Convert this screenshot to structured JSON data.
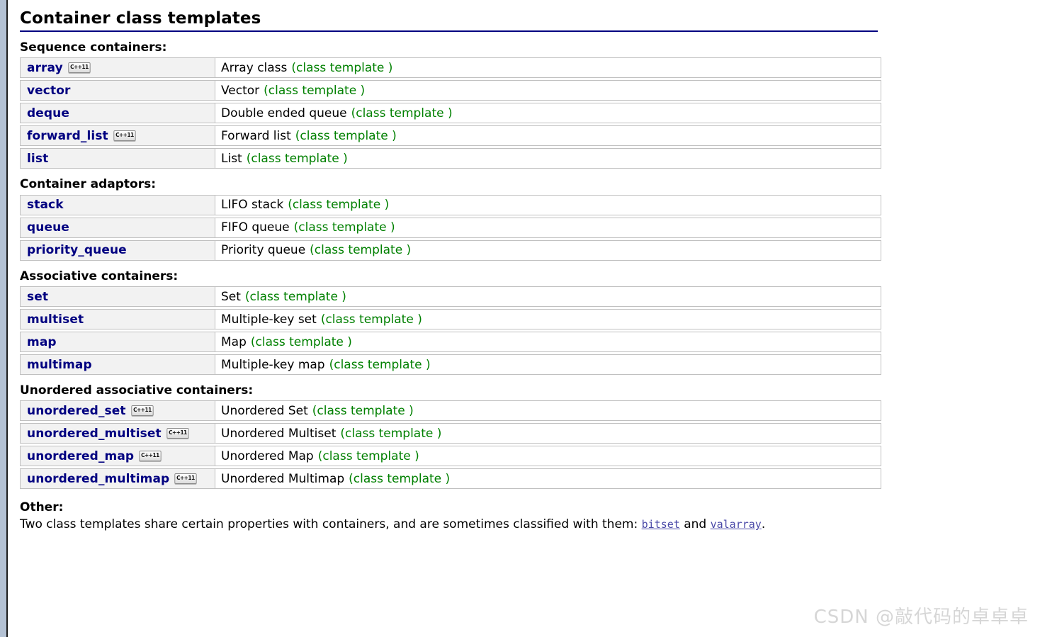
{
  "page": {
    "title": "Container class templates",
    "badge_label": "C++11",
    "template_note": "(class template )"
  },
  "sections": [
    {
      "heading": "Sequence containers",
      "colon": ":",
      "fixed_column": true,
      "rows": [
        {
          "name": "array",
          "badge": true,
          "desc": "Array class",
          "template": "(class template )"
        },
        {
          "name": "vector",
          "badge": false,
          "desc": "Vector",
          "template": "(class template )"
        },
        {
          "name": "deque",
          "badge": false,
          "desc": "Double ended queue",
          "template": "(class template )"
        },
        {
          "name": "forward_list",
          "badge": true,
          "desc": "Forward list",
          "template": "(class template )"
        },
        {
          "name": "list",
          "badge": false,
          "desc": "List",
          "template": "(class template )"
        }
      ]
    },
    {
      "heading": "Container adaptors",
      "colon": ":",
      "fixed_column": true,
      "rows": [
        {
          "name": "stack",
          "badge": false,
          "desc": "LIFO stack",
          "template": "(class template )"
        },
        {
          "name": "queue",
          "badge": false,
          "desc": "FIFO queue",
          "template": "(class template )"
        },
        {
          "name": "priority_queue",
          "badge": false,
          "desc": "Priority queue",
          "template": "(class template )"
        }
      ]
    },
    {
      "heading": "Associative containers",
      "colon": ":",
      "fixed_column": true,
      "rows": [
        {
          "name": "set",
          "badge": false,
          "desc": "Set",
          "template": "(class template )"
        },
        {
          "name": "multiset",
          "badge": false,
          "desc": "Multiple-key set",
          "template": "(class template )"
        },
        {
          "name": "map",
          "badge": false,
          "desc": "Map",
          "template": "(class template )"
        },
        {
          "name": "multimap",
          "badge": false,
          "desc": "Multiple-key map",
          "template": "(class template )"
        }
      ]
    },
    {
      "heading": "Unordered associative containers",
      "colon": ":",
      "fixed_column": false,
      "rows": [
        {
          "name": "unordered_set",
          "badge": true,
          "desc": "Unordered Set",
          "template": "(class template )"
        },
        {
          "name": "unordered_multiset",
          "badge": true,
          "desc": "Unordered Multiset",
          "template": "(class template )"
        },
        {
          "name": "unordered_map",
          "badge": true,
          "desc": "Unordered Map",
          "template": "(class template )"
        },
        {
          "name": "unordered_multimap",
          "badge": true,
          "desc": "Unordered Multimap",
          "template": "(class template )"
        }
      ]
    }
  ],
  "other": {
    "heading": "Other",
    "colon": ":",
    "text_before": "Two class templates share certain properties with containers, and are sometimes classified with them: ",
    "link1": "bitset",
    "text_middle": " and ",
    "link2": "valarray",
    "text_after": "."
  },
  "watermark": "CSDN @敲代码的卓卓卓",
  "colors": {
    "link": "#000080",
    "template_green": "#008000",
    "title_rule": "#000080",
    "cell_bg": "#f2f2f2",
    "border": "#c0c0c0",
    "mono_link": "#4a49a8",
    "gutter": "#b4c2d4",
    "watermark": "#d6d6d6"
  }
}
